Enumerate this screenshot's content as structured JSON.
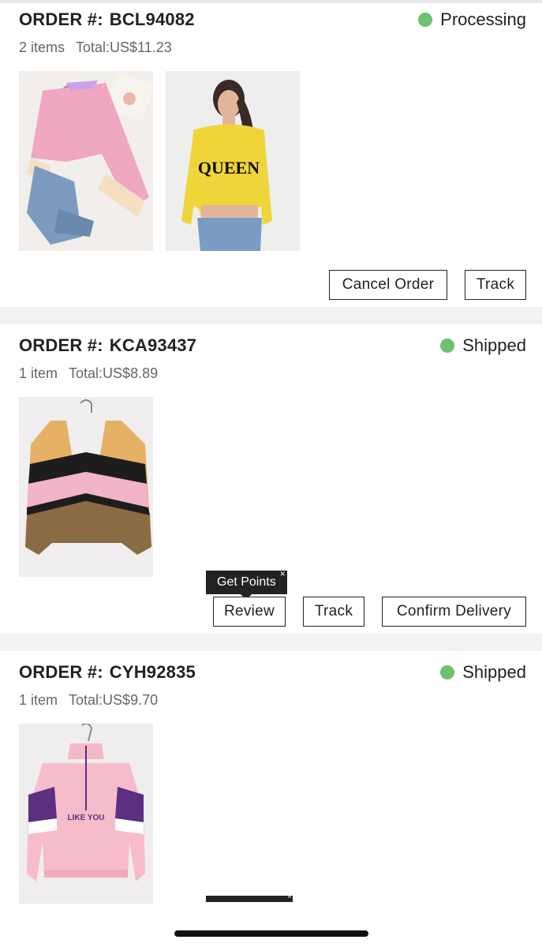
{
  "orders": [
    {
      "label": "ORDER #:",
      "number": "BCL94082",
      "items": "2 items",
      "total": "Total:US$11.23",
      "status": "Processing",
      "status_color": "#6ec16e",
      "actions": [
        "Cancel Order",
        "Track"
      ],
      "products": [
        "pink-knit-sweater-with-jeans",
        "yellow-queen-crop-sweatshirt"
      ]
    },
    {
      "label": "ORDER #:",
      "number": "KCA93437",
      "items": "1 item",
      "total": "Total:US$8.89",
      "status": "Shipped",
      "status_color": "#6ec16e",
      "actions": [
        "Review",
        "Track",
        "Confirm Delivery"
      ],
      "tooltip": "Get Points",
      "tooltip_close": "×",
      "products": [
        "colorblock-knit-cardigan"
      ]
    },
    {
      "label": "ORDER #:",
      "number": "CYH92835",
      "items": "1 item",
      "total": "Total:US$9.70",
      "status": "Shipped",
      "status_color": "#6ec16e",
      "products": [
        "pink-colorblock-pullover"
      ],
      "product_text": "LIKE YOU",
      "tooltip_close": "×"
    }
  ],
  "product_text_1": "QUEEN"
}
